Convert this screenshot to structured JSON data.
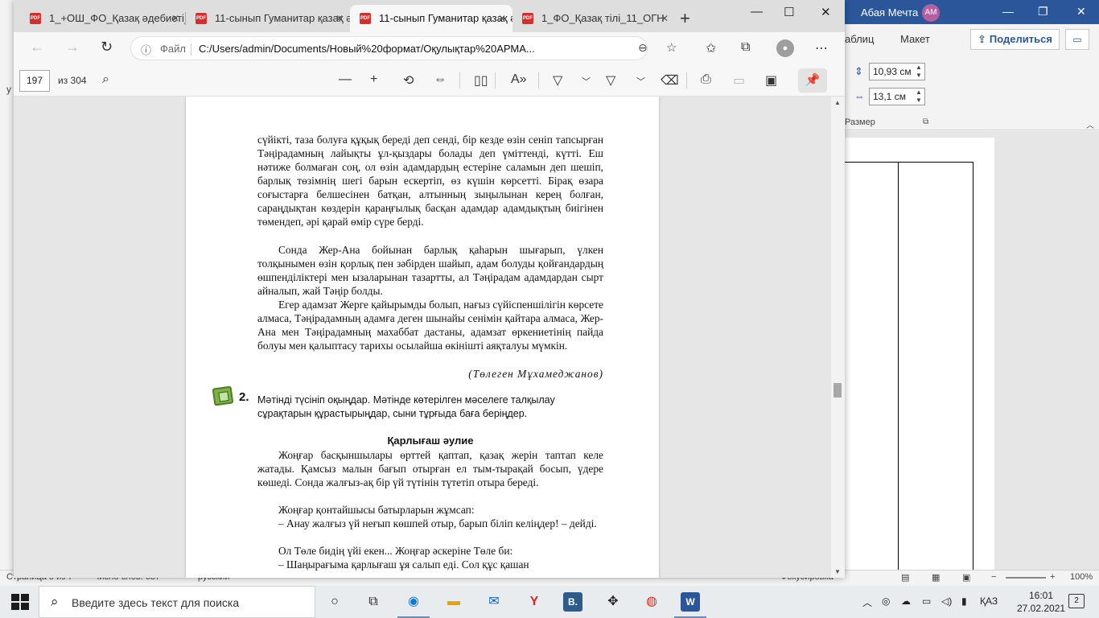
{
  "word": {
    "user_name": "Абая Мечта",
    "user_initials": "AM",
    "ribbon_tabs": [
      "аблиц",
      "Макет"
    ],
    "share_label": "Поделиться",
    "height_value": "10,93 см",
    "width_value": "13,1 см",
    "size_group_label": "Размер",
    "left_fragment": "у",
    "left_fragment2": "ь",
    "status_page": "Страница 5 из 7",
    "status_words": "Число слов: 687",
    "status_lang": "русский",
    "status_focus": "Фокусировка",
    "status_zoom": "100%"
  },
  "browser": {
    "tabs": [
      {
        "label": "1_+ОШ_ФО_Қазақ әдебиеті_11_ОГН",
        "active": false
      },
      {
        "label": "11-сынып Гуманитар қазақ әдебиеті",
        "active": false
      },
      {
        "label": "11-сынып Гуманитар қазақ әдебиеті",
        "active": true
      },
      {
        "label": "1_ФО_Қазақ тілі_11_ОГН",
        "active": false
      }
    ],
    "url_label": "Файл",
    "url": "C:/Users/admin/Documents/Новый%20формат/Оқулықтар%20АРМА..."
  },
  "pdf": {
    "page_current": "197",
    "page_total": "из 304"
  },
  "document": {
    "para1": "сүйікті, таза болуға құқық береді деп сенді, бір кезде өзін сеніп тапсырған Тәңірадамның лайықты ұл-қыздары болады деп үміттенді, күтті. Еш нәтиже болмаған соң, ол өзін адамдардың естеріне саламын деп шешіп, барлық төзімнің шегі барын ескертіп, өз күшін көрсетті. Бірақ өзара соғыстарға белшесінен батқан, алтынның зыңылынан керең болған, сараңдықтан көздерін қараңғылық басқан адамдар адамдықтың биігінен төмендеп, әрі қарай өмір сүре берді.",
    "para2": "Сонда Жер-Ана бойынан барлық қаһарын шығарып, үлкен толқынымен өзін қорлық пен зәбірден шайып, адам болуды қойғандардың өшпенділіктері мен ызаларынан тазартты, ал Тәңірадам адамдардан сырт айналып, жай Тәңір болды.",
    "para3": "Егер адамзат Жерге қайырымды болып, нағыз сүйіспеншілігін көрсете алмаса, Тәңірадамның адамға деген шынайы сенімін қайтара алмаса, Жер-Ана мен Тәңірадамның махаббат дастаны, адамзат өркениетінің пайда болуы мен қалыптасу тарихы осылайша өкінішті аяқталуы мүмкін.",
    "author": "(Төлеген Мұхамеджанов)",
    "task_number": "2.",
    "task_text": "Мәтінді түсініп оқыңдар. Мәтінде көтерілген мәселеге талқылау сұрақтарын құрастырыңдар, сыни тұрғыда баға беріңдер.",
    "title": "Қарлығаш әулие",
    "para4": "Жоңғар басқыншылары өрттей қаптап, қазақ жерін таптап келе жатады. Қамсыз малын бағып отырған ел тым-тырақай босып, үдере көшеді. Сонда жалғыз-ақ бір үй түтінін түтетіп отыра береді.",
    "para5": "Жоңғар қонтайшысы батырларын жұмсап:",
    "para6": "– Анау жалғыз үй неғып көшпей отыр, барып біліп келіңдер! – дейді.",
    "para7": "Ол Төле бидің үйі екен... Жоңғар әскеріне Төле би:",
    "para8": "– Шаңырағыма қарлығаш ұя салып еді. Сол құс қашан"
  },
  "taskbar": {
    "search_placeholder": "Введите здесь текст для поиска",
    "lang": "ҚАЗ",
    "time": "16:01",
    "date": "27.02.2021",
    "notifications": "2"
  }
}
